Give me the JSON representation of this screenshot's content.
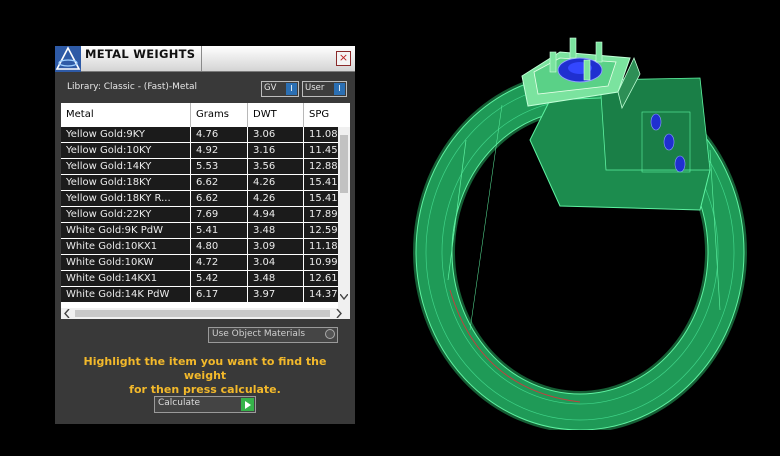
{
  "window": {
    "title": "METAL WEIGHTS",
    "close_glyph": "×"
  },
  "library_label": "Library: Classic - (Fast)-Metal",
  "toggles": {
    "gv_label": "GV",
    "user_label": "User",
    "toggle_glyph": "I"
  },
  "table": {
    "columns": [
      "Metal",
      "Grams",
      "DWT",
      "SPG"
    ],
    "rows": [
      [
        "Yellow Gold:9KY",
        "4.76",
        "3.06",
        "11.08"
      ],
      [
        "Yellow Gold:10KY",
        "4.92",
        "3.16",
        "11.45"
      ],
      [
        "Yellow Gold:14KY",
        "5.53",
        "3.56",
        "12.88"
      ],
      [
        "Yellow Gold:18KY",
        "6.62",
        "4.26",
        "15.41"
      ],
      [
        "Yellow Gold:18KY R...",
        "6.62",
        "4.26",
        "15.41"
      ],
      [
        "Yellow Gold:22KY",
        "7.69",
        "4.94",
        "17.89"
      ],
      [
        "White Gold:9K PdW",
        "5.41",
        "3.48",
        "12.59"
      ],
      [
        "White Gold:10KX1",
        "4.80",
        "3.09",
        "11.18"
      ],
      [
        "White Gold:10KW",
        "4.72",
        "3.04",
        "10.99"
      ],
      [
        "White Gold:14KX1",
        "5.42",
        "3.48",
        "12.61"
      ],
      [
        "White Gold:14K PdW",
        "6.17",
        "3.97",
        "14.37"
      ]
    ]
  },
  "use_object_materials_label": "Use Object Materials",
  "instructions": [
    "Highlight the item you want to find the weight",
    "for then press calculate."
  ],
  "calculate_label": "Calculate",
  "icons": {
    "logo": "app-logo-icon",
    "close": "close-icon",
    "calc_go": "play-arrow-icon",
    "scroll_down": "chevron-down-icon",
    "scroll_left": "chevron-left-icon",
    "scroll_right": "chevron-right-icon"
  },
  "colors": {
    "panel_bg": "#393939",
    "row_bg": "#1b1b1b",
    "instruction_text": "#f3b92b",
    "ring_green": "#1f9a57",
    "gem_blue": "#1f2fd0",
    "go_button": "#36b34a"
  }
}
